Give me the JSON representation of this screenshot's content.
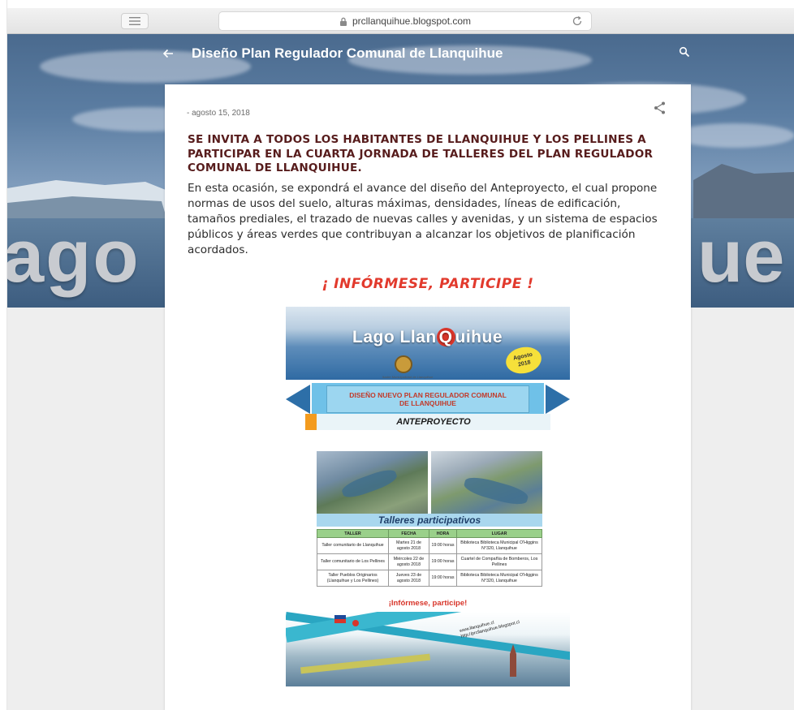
{
  "browser": {
    "url": "prcllanquihue.blogspot.com"
  },
  "blog": {
    "title": "Diseño Plan Regulador Comunal de Llanquihue",
    "header_word_left": "ago",
    "header_word_right": "ue"
  },
  "post": {
    "date": "- agosto 15, 2018",
    "heading": "SE INVITA A TODOS LOS HABITANTES DE LLANQUIHUE Y LOS PELLINES A PARTICIPAR EN LA CUARTA JORNADA DE TALLERES DEL PLAN REGULADOR COMUNAL DE LLANQUIHUE.",
    "body": "En esta ocasión, se expondrá el avance del diseño del Anteproyecto, el cual propone normas de usos del suelo, alturas máximas, densidades, líneas de edificación, tamaños prediales, el trazado de nuevas calles y avenidas, y un sistema de espacios públicos y áreas verdes que contribuyan a alcanzar los objetivos de planificación acordados.",
    "cta": "¡ INFÓRMESE,  PARTICIPE !"
  },
  "poster": {
    "lago_text_a": "Lago Llan",
    "lago_text_q": "Q",
    "lago_text_b": "uihue",
    "badge_line1": "Agosto",
    "badge_line2": "2018",
    "seal_caption": "Ilustre Municipalidad de Llanquihue",
    "ribbon_line1": "DISEÑO NUEVO PLAN REGULADOR COMUNAL",
    "ribbon_line2": "DE LLANQUIHUE",
    "anteproyecto": "ANTEPROYECTO",
    "talleres_title": "Talleres participativos",
    "table": {
      "headers": [
        "TALLER",
        "FECHA",
        "HORA",
        "LUGAR"
      ],
      "rows": [
        [
          "Taller comunitario de Llanquihue",
          "Martes 21 de agosto 2018",
          "19:00 horas",
          "Biblioteca Biblioteca Municipal O'Higgins N°320, Llanquihue"
        ],
        [
          "Taller comunitario de Los Pellines",
          "Miércoles 22 de agosto 2018",
          "19:00 horas",
          "Cuartel de Compañía de Bomberos, Los Pellines"
        ],
        [
          "Taller Pueblos Originarios (Llanquihue y Los Pellines)",
          "Jueves 23 de agosto 2018",
          "19:00 horas",
          "Biblioteca Biblioteca Municipal O'Higgins N°320, Llanquihue"
        ]
      ]
    },
    "cta": "¡Infórmese, participe!",
    "url1": "www.llanquihue.cl",
    "url2": "http://prcllanquihue.blogspot.cl"
  }
}
